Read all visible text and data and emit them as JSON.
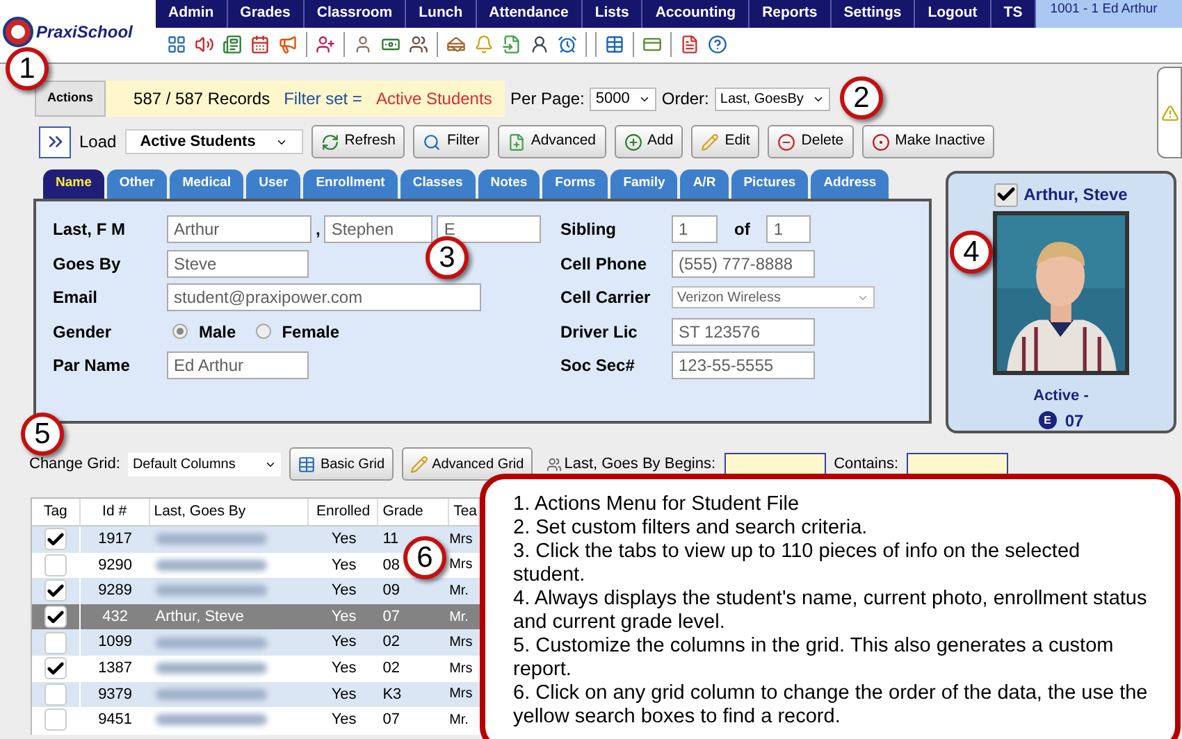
{
  "header": {
    "logo": "PraxiSchool",
    "menu": [
      "Admin",
      "Grades",
      "Classroom",
      "Lunch",
      "Attendance",
      "Lists",
      "Accounting",
      "Reports",
      "Settings",
      "Logout",
      "TS"
    ],
    "user": "1001 - 1 Ed Arthur"
  },
  "actions": {
    "tab": "Actions",
    "records": "587 / 587 Records",
    "filter_label": "Filter set =",
    "filter_value": "Active Students",
    "per_page_label": "Per Page:",
    "per_page": "5000",
    "order_label": "Order:",
    "order": "Last, GoesBy"
  },
  "toolbar": {
    "load_label": "Load",
    "load_value": "Active Students",
    "buttons": [
      {
        "label": "Refresh",
        "kind": "refresh"
      },
      {
        "label": "Filter",
        "kind": "filter"
      },
      {
        "label": "Advanced",
        "kind": "advanced"
      },
      {
        "label": "Add",
        "kind": "add"
      },
      {
        "label": "Edit",
        "kind": "edit"
      },
      {
        "label": "Delete",
        "kind": "delete"
      },
      {
        "label": "Make Inactive",
        "kind": "inactive"
      }
    ]
  },
  "tabs": [
    {
      "label": "Name",
      "selected": true
    },
    {
      "label": "Other",
      "selected": false
    },
    {
      "label": "Medical",
      "selected": false
    },
    {
      "label": "User",
      "selected": false
    },
    {
      "label": "Enrollment",
      "selected": false
    },
    {
      "label": "Classes",
      "selected": false
    },
    {
      "label": "Notes",
      "selected": false
    },
    {
      "label": "Forms",
      "selected": false
    },
    {
      "label": "Family",
      "selected": false
    },
    {
      "label": "A/R",
      "selected": false
    },
    {
      "label": "Pictures",
      "selected": false
    },
    {
      "label": "Address",
      "selected": false
    }
  ],
  "form": {
    "left": [
      {
        "kind": "name",
        "label": "Last, F M",
        "values": [
          "Arthur",
          "Stephen",
          "E"
        ],
        "separator": ","
      },
      {
        "kind": "text",
        "label": "Goes By",
        "value": "Steve"
      },
      {
        "kind": "text",
        "label": "Email",
        "value": "student@praxipower.com"
      },
      {
        "kind": "radio",
        "label": "Gender",
        "options": [
          {
            "label": "Male",
            "selected": true
          },
          {
            "label": "Female",
            "selected": false
          }
        ]
      },
      {
        "kind": "text",
        "label": "Par Name",
        "value": "Ed Arthur"
      }
    ],
    "right": [
      {
        "kind": "pair",
        "label": "Sibling",
        "values": [
          "1",
          "1"
        ],
        "joiner": "of"
      },
      {
        "kind": "text",
        "label": "Cell Phone",
        "value": "(555) 777-8888"
      },
      {
        "kind": "select",
        "label": "Cell Carrier",
        "value": "Verizon Wireless"
      },
      {
        "kind": "text",
        "label": "Driver Lic",
        "value": "ST 123576"
      },
      {
        "kind": "text",
        "label": "Soc Sec#",
        "value": "123-55-5555"
      }
    ]
  },
  "student_card": {
    "tagged": true,
    "name": "Arthur, Steve",
    "status": "Active -",
    "grade_badge": "E",
    "grade": "07"
  },
  "grid_controls": {
    "label": "Change Grid:",
    "value": "Default Columns",
    "buttons": [
      "Basic Grid",
      "Advanced Grid"
    ],
    "search_label": "Last, Goes By Begins:",
    "contains_label": "Contains:"
  },
  "grid": {
    "columns": [
      "Tag",
      "Id #",
      "Last, Goes By",
      "Enrolled",
      "Grade",
      "Tea"
    ],
    "rows": [
      {
        "tagged": true,
        "selected": false,
        "id": "1917",
        "enrolled": "Yes",
        "grade": "11",
        "teacher": "Mrs"
      },
      {
        "tagged": false,
        "selected": false,
        "id": "9290",
        "enrolled": "Yes",
        "grade": "08",
        "teacher": "Mrs"
      },
      {
        "tagged": true,
        "selected": false,
        "id": "9289",
        "enrolled": "Yes",
        "grade": "09",
        "teacher": "Mr."
      },
      {
        "tagged": true,
        "selected": true,
        "id": "432",
        "name": "Arthur, Steve",
        "enrolled": "Yes",
        "grade": "07",
        "teacher": "Mr."
      },
      {
        "tagged": false,
        "selected": false,
        "id": "1099",
        "enrolled": "Yes",
        "grade": "02",
        "teacher": "Mrs"
      },
      {
        "tagged": true,
        "selected": false,
        "id": "1387",
        "enrolled": "Yes",
        "grade": "02",
        "teacher": "Mrs"
      },
      {
        "tagged": false,
        "selected": false,
        "id": "9379",
        "enrolled": "Yes",
        "grade": "K3",
        "teacher": "Mrs"
      },
      {
        "tagged": false,
        "selected": false,
        "id": "9451",
        "enrolled": "Yes",
        "grade": "07",
        "teacher": "Mr."
      }
    ]
  },
  "markers": [
    "1",
    "2",
    "3",
    "4",
    "5",
    "6"
  ],
  "callout": {
    "lines": [
      "1. Actions Menu for Student File",
      "2. Set custom filters and search criteria.",
      "3. Click the tabs to view up to 110 pieces of info on the selected student.",
      "4. Always displays the student's name, current photo, enrollment status and current grade level.",
      "5. Customize the columns in the grid.  This also generates a custom report.",
      "6. Click on any grid column to change the order of the data, the use the yellow search boxes to find a record."
    ]
  }
}
